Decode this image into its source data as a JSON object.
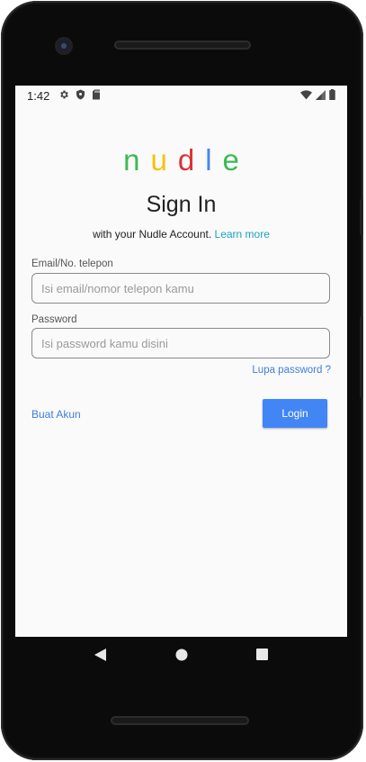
{
  "status_bar": {
    "time": "1:42",
    "icons_left": [
      "gear-icon",
      "shield-icon",
      "sd-card-icon"
    ],
    "icons_right": [
      "wifi-icon",
      "signal-icon",
      "battery-icon"
    ]
  },
  "logo": {
    "letters": [
      {
        "char": "n",
        "color": "#3cba54"
      },
      {
        "char": "u",
        "color": "#f4c20d"
      },
      {
        "char": "d",
        "color": "#db3236"
      },
      {
        "char": "l",
        "color": "#4885ed"
      },
      {
        "char": "e",
        "color": "#3cba54"
      }
    ]
  },
  "title": "Sign In",
  "subtitle": {
    "text": "with your Nudle Account.",
    "link": "Learn more"
  },
  "form": {
    "email_label": "Email/No. telepon",
    "email_placeholder": "Isi email/nomor telepon kamu",
    "email_value": "",
    "password_label": "Password",
    "password_placeholder": "Isi password kamu disini",
    "password_value": "",
    "forgot_link": "Lupa password ?",
    "create_account_link": "Buat Akun",
    "login_button": "Login"
  },
  "colors": {
    "accent": "#4285f4",
    "link": "#3f7fd6",
    "learn_more": "#1aa3c0"
  },
  "nav_bar": {
    "icons": [
      "back-icon",
      "home-icon",
      "recents-icon"
    ]
  }
}
